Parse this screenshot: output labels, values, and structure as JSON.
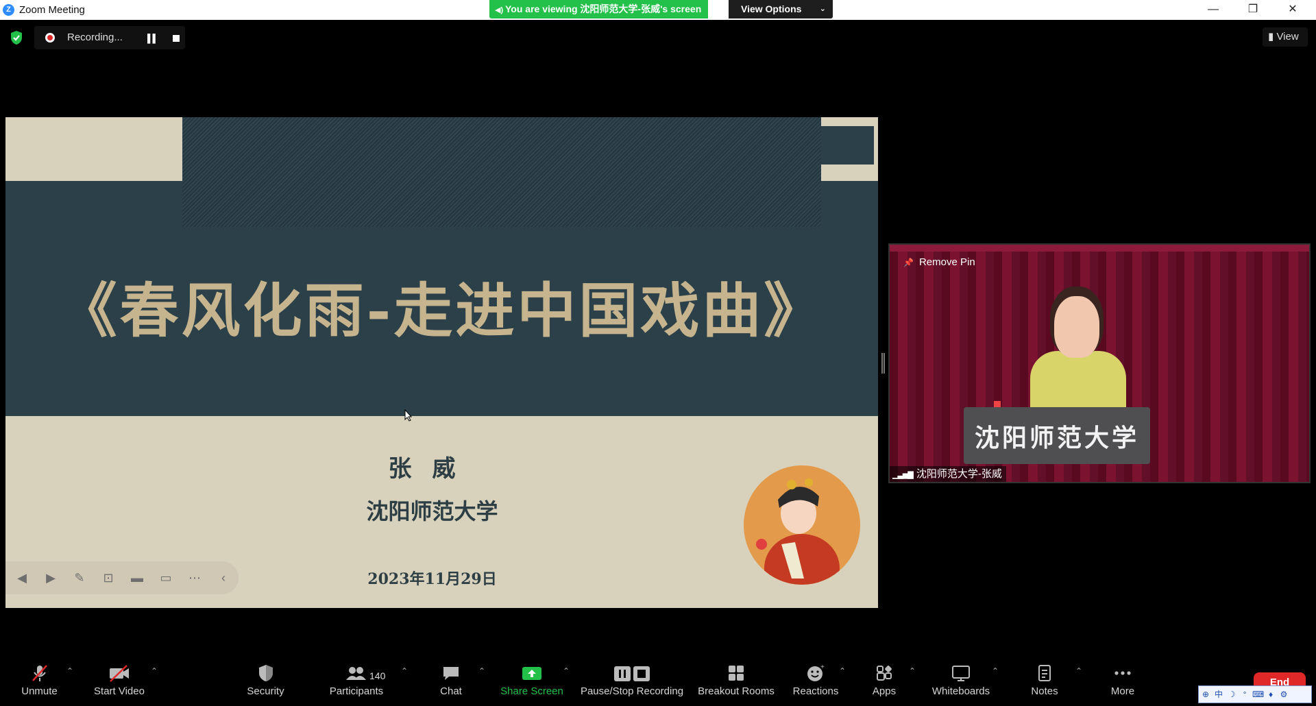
{
  "window": {
    "title": "Zoom Meeting",
    "viewing_banner": "You are viewing 沈阳师范大学-张威's screen",
    "view_options": "View Options",
    "minimize": "—",
    "maximize": "❐",
    "close": "✕"
  },
  "meeting_bar": {
    "recording_label": "Recording...",
    "view_label": "View"
  },
  "shared_slide": {
    "title": "《春风化雨-走进中国戏曲》",
    "presenter": "张威",
    "university": "沈阳师范大学",
    "date": "2023年11月29日"
  },
  "video_tile": {
    "remove_pin": "Remove Pin",
    "participant_name": "沈阳师范大学-张威",
    "podium_text": "沈阳师范大学"
  },
  "toolbar": {
    "unmute": "Unmute",
    "start_video": "Start Video",
    "security": "Security",
    "participants": "Participants",
    "participant_count": "140",
    "chat": "Chat",
    "share_screen": "Share Screen",
    "pause_stop_recording": "Pause/Stop Recording",
    "breakout_rooms": "Breakout Rooms",
    "reactions": "Reactions",
    "apps": "Apps",
    "whiteboards": "Whiteboards",
    "notes": "Notes",
    "more": "More",
    "end": "End"
  },
  "colors": {
    "share_green": "#23c14a",
    "end_red": "#e02828",
    "slide_dark": "#2b4049",
    "slide_cream": "#d8d1bb",
    "slide_gold": "#c5b48d",
    "curtain_red": "#6c0d27"
  },
  "icons": {
    "shield": "shield-check-icon",
    "mic": "mic-muted-icon",
    "video": "video-off-icon",
    "participants": "people-icon",
    "chat": "chat-bubble-icon",
    "share": "share-arrow-icon",
    "recording": "pause-stop-icon",
    "breakout": "grid-icon",
    "reactions": "smiley-icon",
    "apps": "apps-icon",
    "whiteboards": "whiteboard-icon",
    "notes": "notes-icon",
    "more": "ellipsis-icon"
  }
}
